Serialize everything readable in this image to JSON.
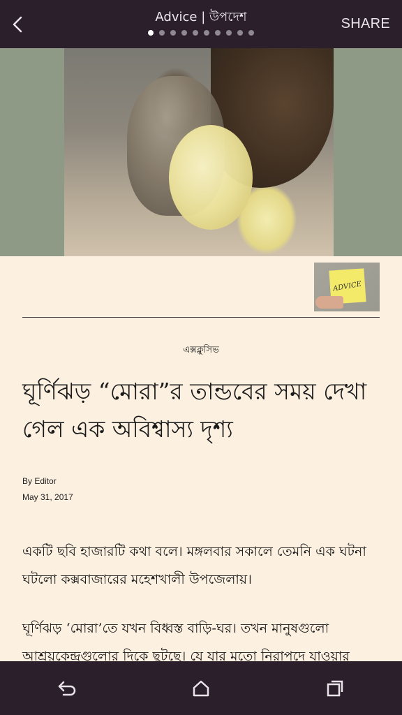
{
  "header": {
    "title": "Advice | উপদেশ",
    "share_label": "SHARE",
    "page_dots_count": 10,
    "active_dot_index": 0
  },
  "hero": {
    "thumbnail_sticky_text": "ADVICE"
  },
  "article": {
    "category": "এক্সক্লুসিভ",
    "headline": "ঘূর্ণিঝড় “মোরা”র তান্ডবের সময় দেখা গেল এক অবিশ্বাস্য দৃশ্য",
    "byline": "By Editor",
    "date": "May 31, 2017",
    "paragraphs": [
      "একটি ছবি হাজারটি কথা বলে। মঙ্গলবার সকালে তেমনি এক ঘটনা ঘটলো কক্সবাজারের মহেশখালী উপজেলায়।",
      "ঘূর্ণিঝড় ‘মোরা’তে যখন বিধ্বস্ত বাড়ি-ঘর। তখন মানুষগুলো আশ্রয়কেন্দ্রগুলোর দিকে ছুটছে। যে যার মতো নিরাপদে যাওয়ার"
    ]
  },
  "colors": {
    "bar_bg": "#2a1f2b",
    "page_bg": "#fcf0e0",
    "active_dot": "#ffffff",
    "inactive_dot": "#8f8794"
  },
  "icons": {
    "back": "chevron-left-icon",
    "nav_back": "back-arrow-icon",
    "nav_home": "home-icon",
    "nav_recents": "recents-icon"
  }
}
